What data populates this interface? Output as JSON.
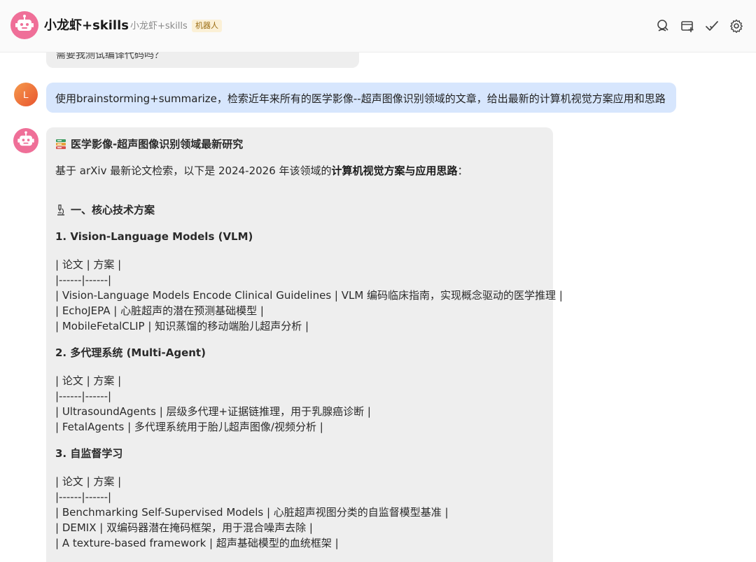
{
  "header": {
    "title": "小龙虾+skills",
    "subtitle": "小龙虾+skills",
    "badge": "机器人",
    "icons": [
      "search-icon",
      "add-chat-icon",
      "check-icon",
      "gear-icon"
    ]
  },
  "conversation": {
    "previous_bot_tail": "需要我测试编译代码吗？",
    "user": {
      "avatar_letter": "L",
      "message": "使用brainstorming+summarize，检索近年来所有的医学影像--超声图像识别领域的文章，给出最新的计算机视觉方案应用和思路"
    },
    "bot": {
      "title": "医学影像-超声图像识别领域最新研究",
      "intro_prefix": "基于 arXiv 最新论文检索，以下是 2024-2026 年该领域的",
      "intro_bold": "计算机视觉方案与应用思路",
      "intro_suffix": "：",
      "section_heading": "一、核心技术方案",
      "sections": [
        {
          "heading": "1. Vision-Language Models (VLM)",
          "table_header": "| 论文 | 方案 |",
          "table_sep": "|------|------|",
          "rows": [
            "| Vision-Language Models Encode Clinical Guidelines | VLM 编码临床指南，实现概念驱动的医学推理 |",
            "| EchoJEPA | 心脏超声的潜在预测基础模型 |",
            "| MobileFetalCLIP | 知识蒸馏的移动端胎儿超声分析 |"
          ]
        },
        {
          "heading": "2. 多代理系统 (Multi-Agent)",
          "table_header": "| 论文 | 方案 |",
          "table_sep": "|------|------|",
          "rows": [
            "| UltrasoundAgents | 层级多代理+证据链推理，用于乳腺癌诊断 |",
            "| FetalAgents | 多代理系统用于胎儿超声图像/视频分析 |"
          ]
        },
        {
          "heading": "3. 自监督学习",
          "table_header": "| 论文 | 方案 |",
          "table_sep": "|------|------|",
          "rows": [
            "| Benchmarking Self-Supervised Models | 心脏超声视图分类的自监督模型基准 |",
            "| DEMIX | 双编码器潜在掩码框架，用于混合噪声去除 |",
            "| A texture-based framework | 超声基础模型的血统框架 |"
          ]
        }
      ]
    }
  },
  "colors": {
    "bot_avatar": "#ef6f98",
    "user_bubble": "#d7e6fd",
    "bot_bubble": "#eeeeee",
    "badge_bg": "#fbf0d6"
  }
}
